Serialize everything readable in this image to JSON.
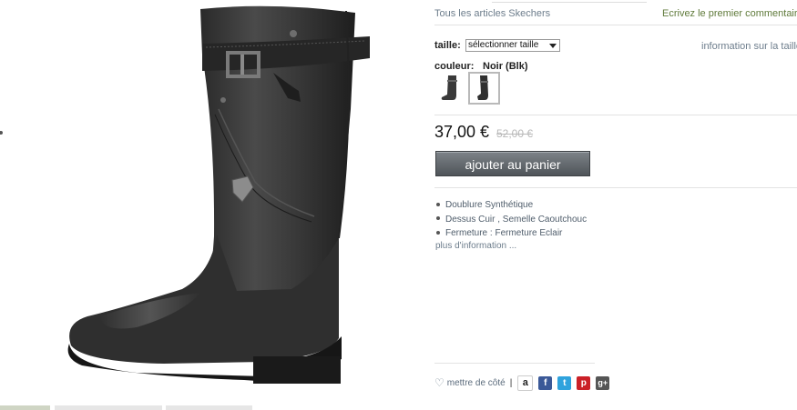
{
  "header": {
    "all_articles_link": "Tous les articles Skechers",
    "review_link": "Ecrivez le premier commentaire"
  },
  "size": {
    "label": "taille:",
    "selected": "sélectionner taille",
    "info_link": "information sur la taille"
  },
  "color": {
    "label": "couleur:",
    "value": "Noir (Blk)"
  },
  "price": {
    "current": "37,00 €",
    "old": "52,00 €"
  },
  "cart": {
    "button_label": "ajouter au panier"
  },
  "features": [
    "Doublure Synthétique",
    "Dessus Cuir , Semelle Caoutchouc",
    "Fermeture : Fermeture Eclair"
  ],
  "more_info_link": "plus d'information ...",
  "share": {
    "wishlist_label": "mettre de côté",
    "separator": "|",
    "icons": [
      "amazon-icon",
      "facebook-icon",
      "twitter-icon",
      "pinterest-icon",
      "google-plus-icon"
    ]
  }
}
